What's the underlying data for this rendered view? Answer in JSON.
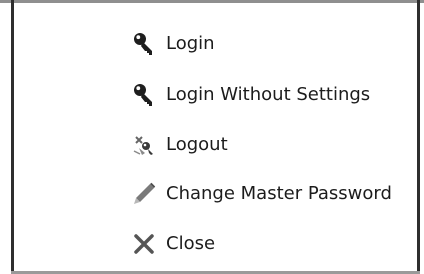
{
  "menu": {
    "items": [
      {
        "label": "Login",
        "icon": "key-icon"
      },
      {
        "label": "Login Without Settings",
        "icon": "key-icon"
      },
      {
        "label": "Logout",
        "icon": "logout-icon"
      },
      {
        "label": "Change Master Password",
        "icon": "pencil-icon"
      },
      {
        "label": "Close",
        "icon": "close-icon"
      }
    ]
  },
  "colors": {
    "text": "#1c1c1c",
    "icon_dark": "#1e1e1e",
    "pencil": "#7a7a7a",
    "close": "#555555",
    "border": "#2e2e2e"
  }
}
